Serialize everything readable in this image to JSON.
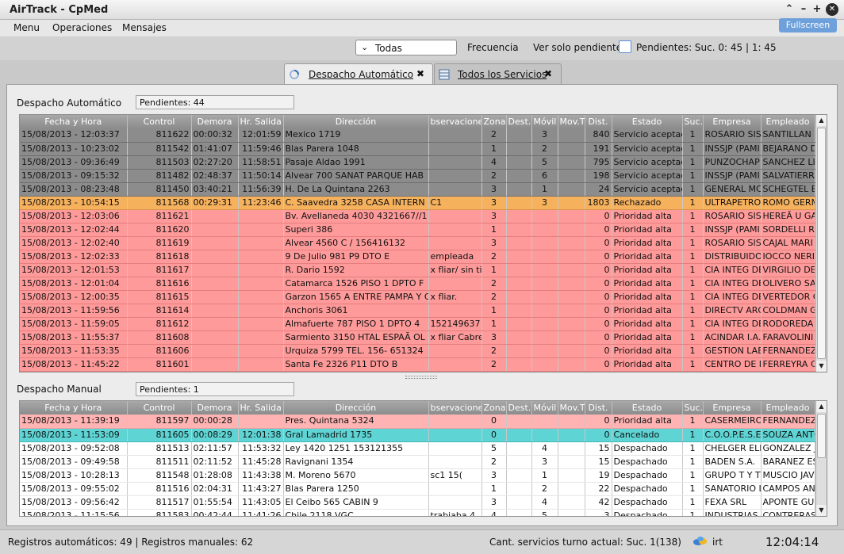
{
  "window": {
    "title": "AirTrack - CpMed",
    "fullscreen": "Fullscreen"
  },
  "menu": [
    "Menu",
    "Operaciones",
    "Mensajes"
  ],
  "toolbar": {
    "filter_value": "Todas",
    "frecuencia": "Frecuencia",
    "ver_solo": "Ver solo pendientes",
    "pendientes": "Pendientes: Suc. 0: 45  |  1: 45"
  },
  "tabs": [
    {
      "label": "Despacho Automático",
      "active": true
    },
    {
      "label": "Todos los Servicios",
      "active": false
    }
  ],
  "columns": [
    "Fecha y Hora",
    "Control",
    "Demora",
    "Hr. Salida",
    "Dirección",
    "bservacione",
    "Zona",
    "Dest.",
    "Móvil",
    "Mov.T",
    "Dist.",
    "Estado",
    "Suc.",
    "Empresa",
    "Empleado"
  ],
  "auto": {
    "title": "Despacho Automático",
    "pendientes": "Pendientes: 44",
    "rows": [
      {
        "s": "gray",
        "c": [
          "15/08/2013 - 12:03:37",
          "811622",
          "00:00:32",
          "12:01:59",
          "Mexico 1719",
          "",
          "2",
          "",
          "3",
          "",
          "840",
          "Servicio aceptad",
          "1",
          "ROSARIO SIST",
          "SANTILLAN M"
        ]
      },
      {
        "s": "gray",
        "c": [
          "15/08/2013 - 10:23:02",
          "811542",
          "01:41:07",
          "11:59:46",
          "Blas Parera 1048",
          "",
          "1",
          "",
          "2",
          "",
          "191",
          "Servicio aceptad",
          "1",
          "INSSJP (PAMI",
          "BEJARANO D"
        ]
      },
      {
        "s": "gray",
        "c": [
          "15/08/2013 - 09:36:49",
          "811503",
          "02:27:20",
          "11:58:51",
          "Pasaje Aldao 1991",
          "",
          "4",
          "",
          "5",
          "",
          "795",
          "Servicio aceptad",
          "1",
          "PUNZOCHAP",
          "SANCHEZ LE"
        ]
      },
      {
        "s": "gray",
        "c": [
          "15/08/2013 - 09:15:32",
          "811482",
          "02:48:37",
          "11:50:14",
          "Alvear 700     SANAT PARQUE HAB",
          "",
          "2",
          "",
          "6",
          "",
          "198",
          "Servicio aceptad",
          "1",
          "INSSJP (PAMI",
          "SALVATIERRA"
        ]
      },
      {
        "s": "gray",
        "c": [
          "15/08/2013 - 08:23:48",
          "811450",
          "03:40:21",
          "11:56:39",
          "H. De La Quintana 2263",
          "",
          "3",
          "",
          "1",
          "",
          "24",
          "Servicio aceptad",
          "1",
          "GENERAL MC",
          "SCHEGTEL BE"
        ]
      },
      {
        "s": "orange",
        "c": [
          "15/08/2013 - 10:54:15",
          "811568",
          "00:29:31",
          "11:23:46",
          "C. Saavedra 3258    CASA INTERN",
          "C1",
          "3",
          "",
          "3",
          "",
          "1803",
          "Rechazado",
          "1",
          "ULTRAPETROL",
          "ROMO GERM"
        ]
      },
      {
        "s": "red",
        "c": [
          "15/08/2013 - 12:03:06",
          "811621",
          "",
          "",
          "Bv. Avellaneda 4030    4321667//1",
          "",
          "3",
          "",
          "",
          "",
          "0",
          "Prioridad alta",
          "1",
          "ROSARIO SIST",
          "HEREÃ U GA"
        ]
      },
      {
        "s": "red",
        "c": [
          "15/08/2013 - 12:02:44",
          "811620",
          "",
          "",
          "Superi 386",
          "",
          "1",
          "",
          "",
          "",
          "0",
          "Prioridad alta",
          "1",
          "INSSJP (PAMI",
          "SORDELLI RO"
        ]
      },
      {
        "s": "red",
        "c": [
          "15/08/2013 - 12:02:40",
          "811619",
          "",
          "",
          "Alvear 4560     C  /  156416132",
          "",
          "3",
          "",
          "",
          "",
          "0",
          "Prioridad alta",
          "1",
          "ROSARIO SIST",
          "CAJAL MARI"
        ]
      },
      {
        "s": "red",
        "c": [
          "15/08/2013 - 12:02:33",
          "811618",
          "",
          "",
          "9 De Julio 981     P9 DTO E",
          "empleada",
          "2",
          "",
          "",
          "",
          "0",
          "Prioridad alta",
          "1",
          "DISTRIBUIDOR",
          "IOCCO NERI"
        ]
      },
      {
        "s": "red",
        "c": [
          "15/08/2013 - 12:01:53",
          "811617",
          "",
          "",
          "R. Dario 1592",
          "x fliar/ sin tir",
          "1",
          "",
          "",
          "",
          "0",
          "Prioridad alta",
          "1",
          "CIA INTEG DE",
          "VIRGILIO DE"
        ]
      },
      {
        "s": "red",
        "c": [
          "15/08/2013 - 12:01:04",
          "811616",
          "",
          "",
          "Catamarca 1526     PISO 1 DPTO F",
          "",
          "2",
          "",
          "",
          "",
          "0",
          "Prioridad alta",
          "1",
          "CIA INTEG DE",
          "OLIVERO SA"
        ]
      },
      {
        "s": "red",
        "c": [
          "15/08/2013 - 12:00:35",
          "811615",
          "",
          "",
          "Garzon 1565 A     ENTRE PAMPA Y C",
          "x fliar.",
          "2",
          "",
          "",
          "",
          "0",
          "Prioridad alta",
          "1",
          "CIA INTEG DE",
          "VERTEDOR C"
        ]
      },
      {
        "s": "red",
        "c": [
          "15/08/2013 - 11:59:56",
          "811614",
          "",
          "",
          "Anchoris 3061",
          "",
          "1",
          "",
          "",
          "",
          "0",
          "Prioridad alta",
          "1",
          "DIRECTV ARG",
          "COLDMAN G"
        ]
      },
      {
        "s": "red",
        "c": [
          "15/08/2013 - 11:59:05",
          "811612",
          "",
          "",
          "Almafuerte 787     PISO 1 DPTO 4",
          "152149637",
          "1",
          "",
          "",
          "",
          "0",
          "Prioridad alta",
          "1",
          "CIA INTEG DE",
          "RODOREDA"
        ]
      },
      {
        "s": "red",
        "c": [
          "15/08/2013 - 11:55:37",
          "811608",
          "",
          "",
          "Sarmiento 3150     HTAL ESPAÃ OL",
          "x fliar Cabre",
          "3",
          "",
          "",
          "",
          "0",
          "Prioridad alta",
          "1",
          "ACINDAR I.A.",
          "FARAVOLINI"
        ]
      },
      {
        "s": "red",
        "c": [
          "15/08/2013 - 11:53:35",
          "811606",
          "",
          "",
          "Urquiza 5799     TEL. 156- 651324",
          "",
          "2",
          "",
          "",
          "",
          "0",
          "Prioridad alta",
          "1",
          "GESTION LAB",
          "FERNANDEZ"
        ]
      },
      {
        "s": "red",
        "c": [
          "15/08/2013 - 11:45:22",
          "811601",
          "",
          "",
          "Santa Fe 2326     P11 DTO B",
          "",
          "2",
          "",
          "",
          "",
          "0",
          "Prioridad alta",
          "1",
          "CENTRO DE D",
          "FERREYRA C"
        ]
      }
    ]
  },
  "manual": {
    "title": "Despacho Manual",
    "pendientes": "Pendientes: 1",
    "rows": [
      {
        "s": "pink",
        "c": [
          "15/08/2013 - 11:39:19",
          "811597",
          "00:00:28",
          "",
          "Pres. Quintana 5324",
          "",
          "0",
          "",
          "",
          "",
          "0",
          "Prioridad alta",
          "1",
          "CASERMEIRO",
          "FERNANDEZ"
        ]
      },
      {
        "s": "teal",
        "c": [
          "15/08/2013 - 11:53:09",
          "811605",
          "00:08:29",
          "12:01:38",
          "Gral  Lamadrid 1735",
          "",
          "0",
          "",
          "",
          "",
          "0",
          "Cancelado",
          "1",
          "C.O.O.P.E.S.E",
          "SOUZA ANTO"
        ]
      },
      {
        "s": "white",
        "c": [
          "15/08/2013 - 09:52:08",
          "811513",
          "02:11:57",
          "11:53:32",
          "Ley 1420 1251     153121355",
          "",
          "5",
          "",
          "4",
          "",
          "15",
          "Despachado",
          "1",
          "CHELGER ELI",
          "GONZALEZ J"
        ]
      },
      {
        "s": "white",
        "c": [
          "15/08/2013 - 09:49:58",
          "811511",
          "02:11:52",
          "11:45:28",
          "Ravignani 1354",
          "",
          "2",
          "",
          "3",
          "",
          "15",
          "Despachado",
          "1",
          "BADEN S.A.",
          "BARANEZ EST"
        ]
      },
      {
        "s": "white",
        "c": [
          "15/08/2013 - 10:28:13",
          "811548",
          "01:28:08",
          "11:43:38",
          "M. Moreno 5670",
          "sc1         15(",
          "3",
          "",
          "1",
          "",
          "19",
          "Despachado",
          "1",
          "GRUPO T Y T S",
          "MUSCIO JAV"
        ]
      },
      {
        "s": "white",
        "c": [
          "15/08/2013 - 09:55:02",
          "811516",
          "02:04:31",
          "11:43:27",
          "Blas Parera 1250",
          "",
          "1",
          "",
          "2",
          "",
          "22",
          "Despachado",
          "1",
          "SANATORIO L",
          "CAMPOS AN"
        ]
      },
      {
        "s": "white",
        "c": [
          "15/08/2013 - 09:56:42",
          "811517",
          "01:55:54",
          "11:43:05",
          "El Ceibo 565     CABIN 9",
          "",
          "3",
          "",
          "4",
          "",
          "42",
          "Despachado",
          "1",
          "FEXA SRL",
          "APONTE GUS"
        ]
      },
      {
        "s": "white",
        "c": [
          "15/08/2013 - 11:15:56",
          "811583",
          "00:42:44",
          "11:41:26",
          "Chile 2118     VGC",
          "trabiaba 4",
          "4",
          "",
          "5",
          "",
          "3",
          "Despachado",
          "1",
          "INDUSTRIAS S",
          "CONTRERAS"
        ]
      }
    ]
  },
  "status": {
    "left": "Registros automáticos: 49  |  Registros manuales: 62",
    "center": "Cant. servicios turno actual: Suc. 1(138)",
    "user": "irt",
    "clock": "12:04:14"
  }
}
